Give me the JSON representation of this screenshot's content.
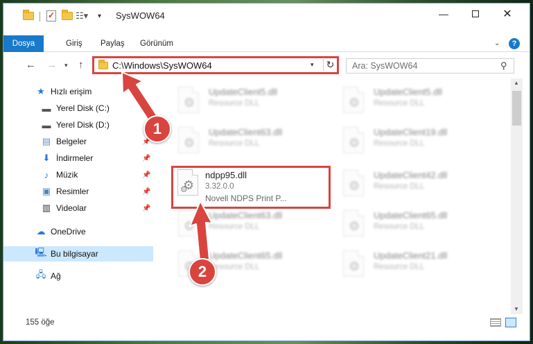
{
  "window": {
    "title": "SysWOW64"
  },
  "ribbon": {
    "tabs": [
      "Dosya",
      "Giriş",
      "Paylaş",
      "Görünüm"
    ]
  },
  "address": {
    "path": "C:\\Windows\\SysWOW64"
  },
  "search": {
    "placeholder": "Ara: SysWOW64"
  },
  "sidebar": {
    "items": [
      {
        "label": "Hızlı erişim",
        "icon": "star-icon"
      },
      {
        "label": "Yerel Disk (C:)",
        "icon": "drive-icon"
      },
      {
        "label": "Yerel Disk (D:)",
        "icon": "drive-icon"
      },
      {
        "label": "Belgeler",
        "icon": "documents-icon"
      },
      {
        "label": "İndirmeler",
        "icon": "download-icon"
      },
      {
        "label": "Müzik",
        "icon": "music-icon"
      },
      {
        "label": "Resimler",
        "icon": "pictures-icon"
      },
      {
        "label": "Videolar",
        "icon": "videos-icon"
      },
      {
        "label": "OneDrive",
        "icon": "cloud-icon"
      },
      {
        "label": "Bu bilgisayar",
        "icon": "computer-icon"
      },
      {
        "label": "Ağ",
        "icon": "network-icon"
      }
    ]
  },
  "files": {
    "left": [
      {
        "name": "UpdateClient5.dll",
        "desc": "Resource DLL"
      },
      {
        "name": "UpdateClient63.dll",
        "desc": "Resource DLL"
      },
      {
        "name": "UpdateClient63.dll",
        "desc": "Resource DLL"
      },
      {
        "name": "UpdateClient65.dll",
        "desc": "Resource DLL"
      }
    ],
    "right": [
      {
        "name": "UpdateClient5.dll",
        "desc": "Resource DLL"
      },
      {
        "name": "UpdateClient19.dll",
        "desc": "Resource DLL"
      },
      {
        "name": "UpdateClient42.dll",
        "desc": "Resource DLL"
      },
      {
        "name": "UpdateClient65.dll",
        "desc": "Resource DLL"
      },
      {
        "name": "UpdateClient21.dll",
        "desc": "Resource DLL"
      }
    ],
    "highlighted": {
      "name": "ndpp95.dll",
      "version": "3.32.0.0",
      "desc": "Novell NDPS Print P..."
    }
  },
  "status": {
    "count": "155 öğe"
  },
  "annotations": {
    "step1": "1",
    "step2": "2",
    "color": "#d9443f"
  }
}
